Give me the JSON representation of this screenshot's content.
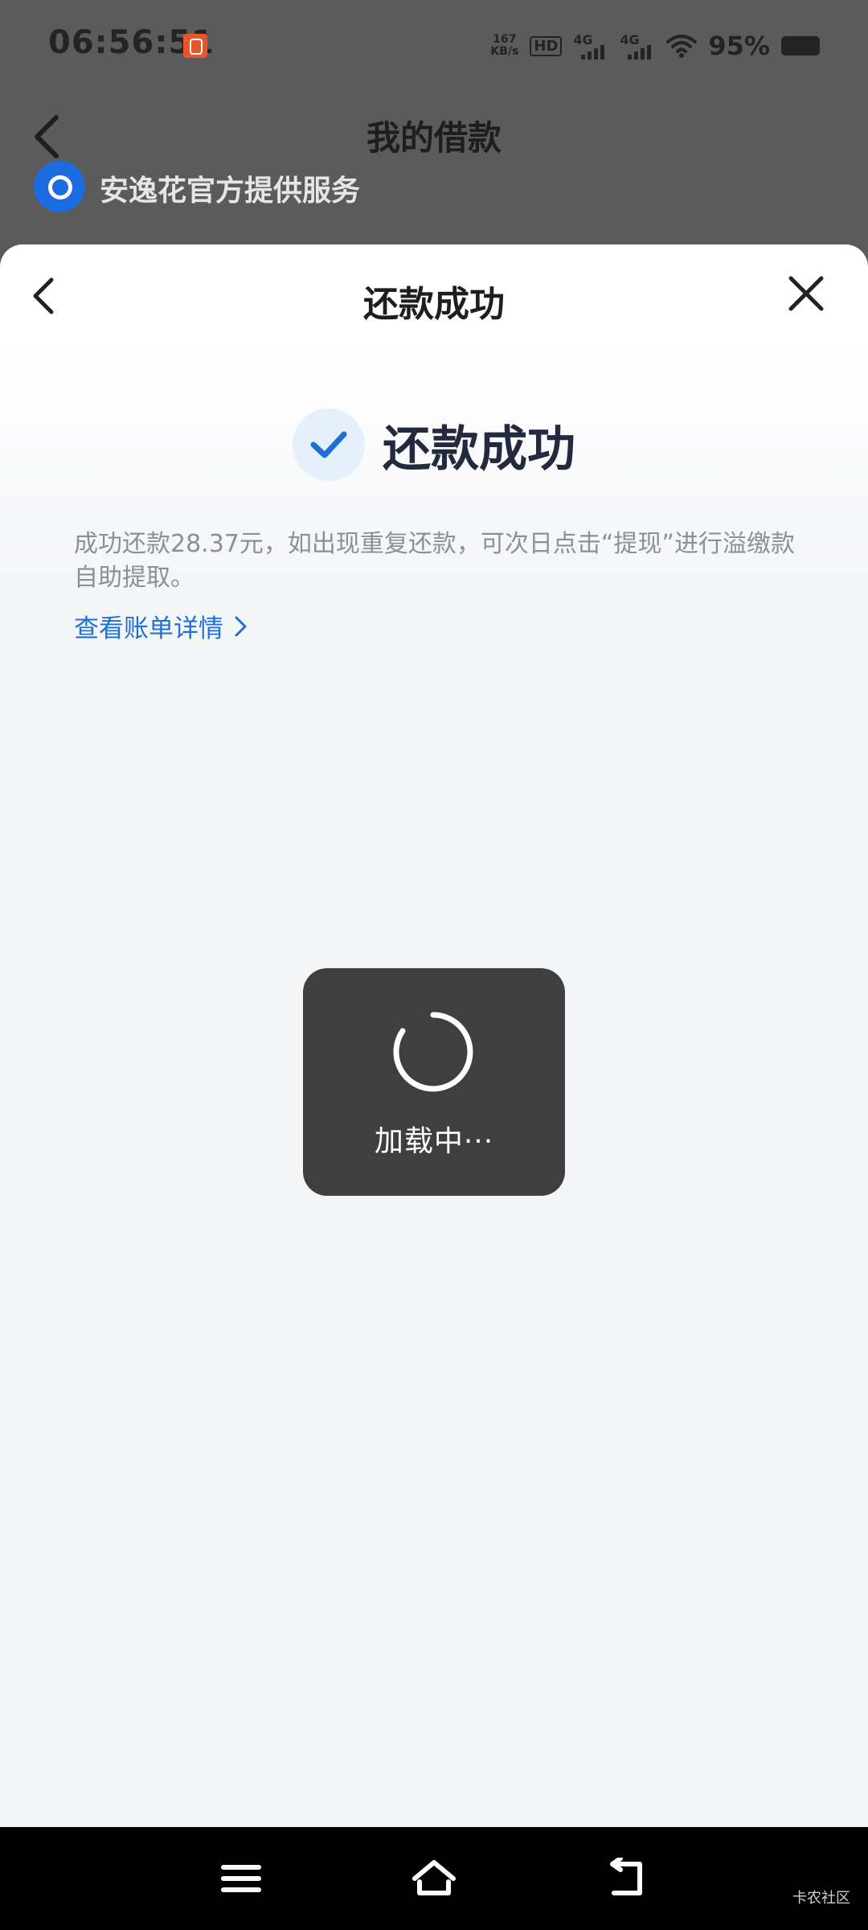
{
  "status_bar": {
    "time": "06:56:51",
    "network_speed": "167",
    "network_speed_unit": "KB/s",
    "hd_label": "HD",
    "sim1_label": "4G",
    "sim2_label": "4G",
    "battery_percent": "95%"
  },
  "background_page": {
    "title": "我的借款",
    "provider_text": "安逸花官方提供服务"
  },
  "sheet": {
    "title": "还款成功",
    "success_title": "还款成功",
    "description": "成功还款28.37元，如出现重复还款，可次日点击“提现”进行溢缴款自助提取。",
    "link_label": "查看账单详情"
  },
  "loading": {
    "text": "加载中···"
  },
  "watermark": "卡农社区",
  "colors": {
    "accent": "#1f6fd6",
    "check_bg": "#e4f0fb",
    "toast_bg": "#3f3f3f"
  }
}
